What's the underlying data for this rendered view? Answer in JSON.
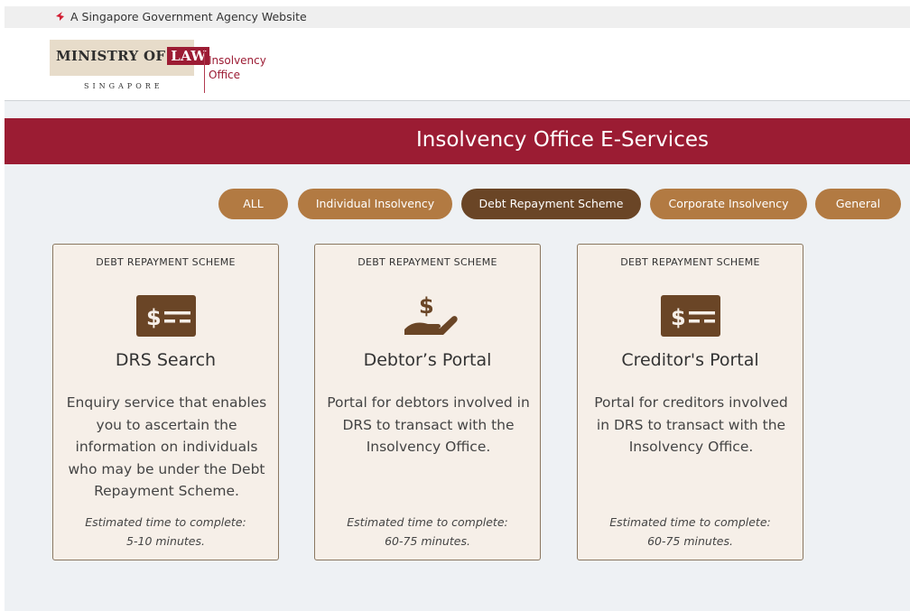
{
  "masthead": {
    "text": "A Singapore Government Agency Website",
    "icon": "lion-head-icon"
  },
  "header": {
    "logo_main": "MINISTRY OF",
    "logo_law": "LAW",
    "logo_country": "SINGAPORE",
    "logo_sub_line1": "Insolvency",
    "logo_sub_line2": "Office"
  },
  "banner": {
    "title": "Insolvency Office E-Services"
  },
  "filters": [
    {
      "label": "ALL",
      "active": false
    },
    {
      "label": "Individual Insolvency",
      "active": false
    },
    {
      "label": "Debt Repayment Scheme",
      "active": true
    },
    {
      "label": "Corporate Insolvency",
      "active": false
    },
    {
      "label": "General",
      "active": false
    }
  ],
  "cards": [
    {
      "category": "DEBT REPAYMENT SCHEME",
      "icon": "money-check-icon",
      "title": "DRS Search",
      "description": "Enquiry service that enables you to ascertain the information on individuals who may be under the Debt Repayment Scheme.",
      "time_label": "Estimated time to complete:",
      "time_value": "5-10 minutes."
    },
    {
      "category": "DEBT REPAYMENT SCHEME",
      "icon": "hand-holding-dollar-icon",
      "title": "Debtor’s Portal",
      "description": "Portal for debtors involved in DRS to transact with the Insolvency Office.",
      "time_label": "Estimated time to complete:",
      "time_value": "60-75 minutes."
    },
    {
      "category": "DEBT REPAYMENT SCHEME",
      "icon": "money-check-icon",
      "title": "Creditor's Portal",
      "description": "Portal for creditors involved in DRS to transact with the Insolvency Office.",
      "time_label": "Estimated time to complete:",
      "time_value": "60-75 minutes."
    }
  ],
  "colors": {
    "brand_red": "#9b1c33",
    "pill": "#b27a42",
    "pill_active": "#6a4526",
    "icon_brown": "#6a4526"
  }
}
